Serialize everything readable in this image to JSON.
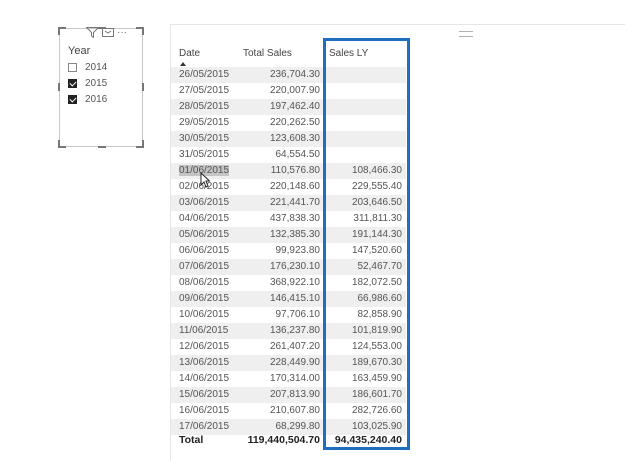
{
  "slicer": {
    "title": "Year",
    "more_label": "···",
    "items": [
      {
        "label": "2014",
        "checked": false
      },
      {
        "label": "2015",
        "checked": true
      },
      {
        "label": "2016",
        "checked": true
      }
    ]
  },
  "table": {
    "columns": [
      "Date",
      "Total Sales",
      "Sales LY"
    ],
    "sort_column": "Date",
    "sort_direction": "ascending",
    "rows": [
      {
        "date": "26/05/2015",
        "sales": "236,704.30",
        "ly": ""
      },
      {
        "date": "27/05/2015",
        "sales": "220,007.90",
        "ly": ""
      },
      {
        "date": "28/05/2015",
        "sales": "197,462.40",
        "ly": ""
      },
      {
        "date": "29/05/2015",
        "sales": "220,262.50",
        "ly": ""
      },
      {
        "date": "30/05/2015",
        "sales": "123,608.30",
        "ly": ""
      },
      {
        "date": "31/05/2015",
        "sales": "64,554.50",
        "ly": ""
      },
      {
        "date": "01/06/2015",
        "sales": "110,576.80",
        "ly": "108,466.30"
      },
      {
        "date": "02/06/2015",
        "sales": "220,148.60",
        "ly": "229,555.40"
      },
      {
        "date": "03/06/2015",
        "sales": "221,441.70",
        "ly": "203,646.50"
      },
      {
        "date": "04/06/2015",
        "sales": "437,838.30",
        "ly": "311,811.30"
      },
      {
        "date": "05/06/2015",
        "sales": "132,385.30",
        "ly": "191,144.30"
      },
      {
        "date": "06/06/2015",
        "sales": "99,923.80",
        "ly": "147,520.60"
      },
      {
        "date": "07/06/2015",
        "sales": "176,230.10",
        "ly": "52,467.70"
      },
      {
        "date": "08/06/2015",
        "sales": "368,922.10",
        "ly": "182,072.50"
      },
      {
        "date": "09/06/2015",
        "sales": "146,415.10",
        "ly": "66,986.60"
      },
      {
        "date": "10/06/2015",
        "sales": "97,706.10",
        "ly": "82,858.90"
      },
      {
        "date": "11/06/2015",
        "sales": "136,237.80",
        "ly": "101,819.90"
      },
      {
        "date": "12/06/2015",
        "sales": "261,407.20",
        "ly": "124,553.00"
      },
      {
        "date": "13/06/2015",
        "sales": "228,449.90",
        "ly": "189,670.30"
      },
      {
        "date": "14/06/2015",
        "sales": "170,314.00",
        "ly": "163,459.90"
      },
      {
        "date": "15/06/2015",
        "sales": "207,813.90",
        "ly": "186,601.70"
      },
      {
        "date": "16/06/2015",
        "sales": "210,607.80",
        "ly": "282,726.60"
      },
      {
        "date": "17/06/2015",
        "sales": "68,299.80",
        "ly": "103,025.90"
      }
    ],
    "total": {
      "label": "Total",
      "sales": "119,440,504.70",
      "ly": "94,435,240.40"
    }
  },
  "colors": {
    "highlight_border": "#1e6fbf",
    "row_alt": "#efefef"
  }
}
